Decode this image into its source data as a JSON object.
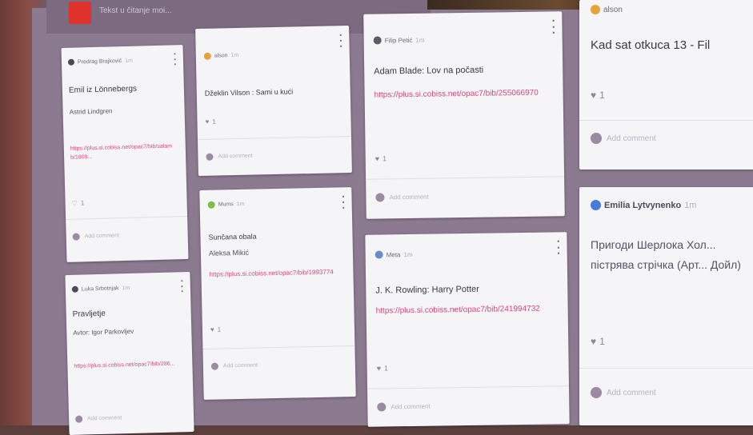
{
  "header": {
    "subtitle": "Tekst u čitanje moi..."
  },
  "cards": [
    {
      "author": "Predrag Brajković",
      "time": "1m",
      "avatar_color": "#4a4a55",
      "title": "Emil iz Lönnebergs",
      "subtitle": "Astrid Lindgren",
      "link": "https://plus.si.cobiss.net/opac7/bib/salamb/1809...",
      "likes": "1",
      "comment_placeholder": "Add comment"
    },
    {
      "author": "Luka Srbotnjak",
      "time": "1m",
      "avatar_color": "#4a4a55",
      "title": "Pravljetje",
      "subtitle": "Avtor: Igor Parkovljev",
      "link": "https://plus.si.cobiss.net/opac7/bib/286...",
      "likes": "",
      "comment_placeholder": "Add comment"
    },
    {
      "author": "alson",
      "time": "1m",
      "avatar_color": "#e6a23c",
      "title": "Džeklin Vilson : Sami u kući",
      "subtitle": "",
      "link": "",
      "likes": "1",
      "comment_placeholder": "Add comment"
    },
    {
      "author": "Mums",
      "time": "1m",
      "avatar_color": "#7bbf4a",
      "title": "Sunčana obala",
      "subtitle": "Aleksa Mikić",
      "link": "https://plus.si.cobiss.net/opac7/bib/1993774",
      "likes": "1",
      "comment_placeholder": "Add comment"
    },
    {
      "author": "Filip Petić",
      "time": "1m",
      "avatar_color": "#5c5c66",
      "title": "Adam Blade: Lov na počasti",
      "subtitle": "",
      "link": "https://plus.si.cobiss.net/opac7/bib/255066970",
      "likes": "1",
      "comment_placeholder": "Add comment"
    },
    {
      "author": "Meta",
      "time": "1m",
      "avatar_color": "#6a8cc7",
      "title": "J. K. Rowling: Harry Potter",
      "subtitle": "",
      "link": "https://plus.si.cobiss.net/opac7/bib/241994732",
      "likes": "1",
      "comment_placeholder": "Add comment"
    },
    {
      "author": "alson",
      "time": "",
      "avatar_color": "#e6a23c",
      "title": "Kad sat otkuca 13 - Fil",
      "subtitle": "",
      "link": "",
      "likes": "1",
      "comment_placeholder": "Add comment"
    },
    {
      "author": "Emilia Lytvynenko",
      "time": "1m",
      "avatar_color": "#4a7bd9",
      "title": "Пригоди Шерлока Хол... пістрява стрічка (Арт... Дойл)",
      "subtitle": "",
      "link": "",
      "likes": "1",
      "comment_placeholder": "Add comment"
    }
  ]
}
